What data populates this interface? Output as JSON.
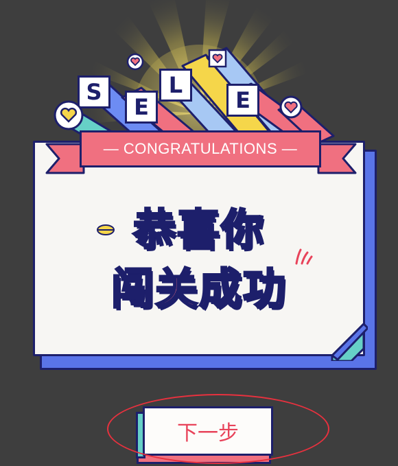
{
  "banner": {
    "letters": [
      "S",
      "E",
      "L",
      "E"
    ],
    "ribbon_text": "— CONGRATULATIONS —"
  },
  "card": {
    "line1": "恭喜你",
    "line2": "闯关成功"
  },
  "next_button": {
    "label": "下一步"
  },
  "colors": {
    "background": "#3e3e3e",
    "navy": "#1d1f6b",
    "pink": "#f07080",
    "blue": "#6d8cf3",
    "yellow": "#f5d64a",
    "teal": "#66d0c7",
    "highlight": "#e8313e"
  },
  "icons": [
    "heart-bubble-icon",
    "lips-icon",
    "sparkle-icon"
  ]
}
